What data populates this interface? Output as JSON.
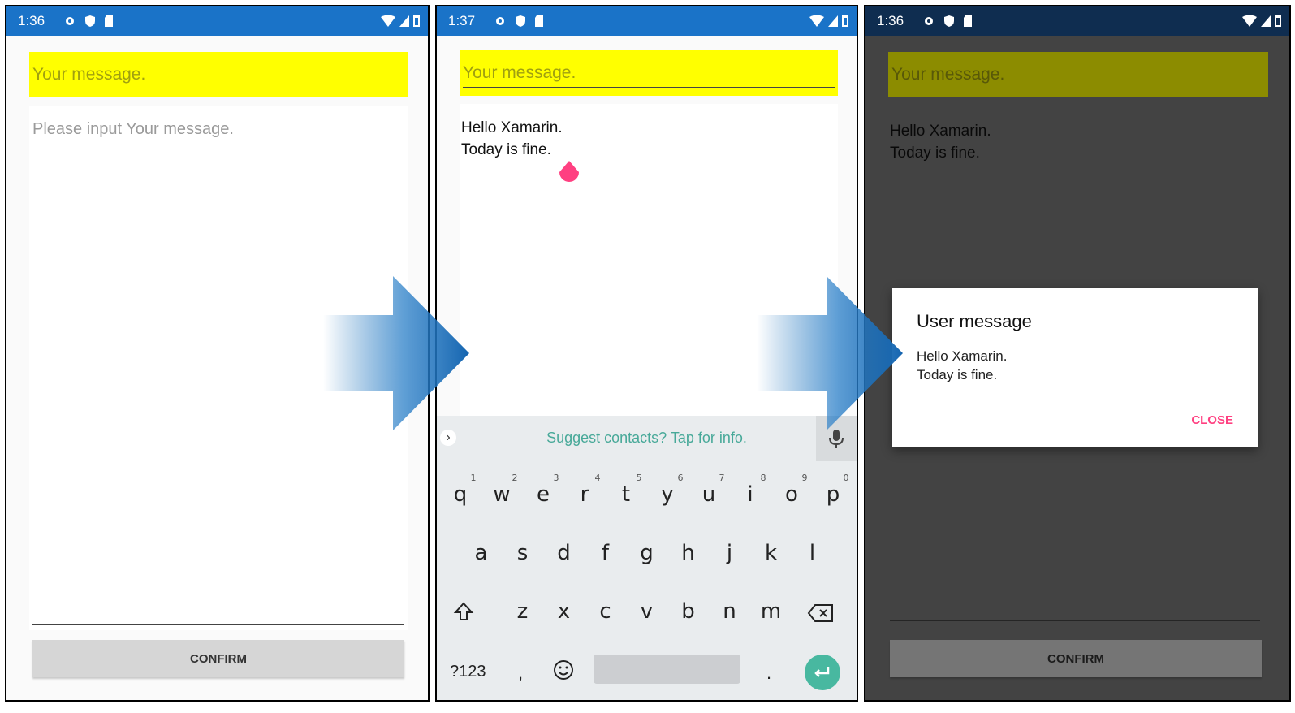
{
  "screens": [
    {
      "time": "1:36",
      "title_label": "Your message.",
      "placeholder": "Please input Your message.",
      "confirm_label": "CONFIRM"
    },
    {
      "time": "1:37",
      "title_label": "Your message.",
      "message_line1": "Hello Xamarin.",
      "message_line2": "Today is fine.",
      "suggestion": "Suggest contacts? Tap for info.",
      "keyboard": {
        "row1": [
          "q",
          "w",
          "e",
          "r",
          "t",
          "y",
          "u",
          "i",
          "o",
          "p"
        ],
        "row1_hints": [
          "1",
          "2",
          "3",
          "4",
          "5",
          "6",
          "7",
          "8",
          "9",
          "0"
        ],
        "row2": [
          "a",
          "s",
          "d",
          "f",
          "g",
          "h",
          "j",
          "k",
          "l"
        ],
        "row3": [
          "z",
          "x",
          "c",
          "v",
          "b",
          "n",
          "m"
        ],
        "symbols_label": "?123",
        "comma": ",",
        "period": "."
      }
    },
    {
      "time": "1:36",
      "title_label": "Your message.",
      "message_line1": "Hello Xamarin.",
      "message_line2": "Today is fine.",
      "confirm_label": "CONFIRM",
      "dialog": {
        "title": "User message",
        "line1": "Hello Xamarin.",
        "line2": "Today is fine.",
        "close_label": "CLOSE"
      }
    }
  ],
  "colors": {
    "statusbar": "#1a73c8",
    "title_highlight": "#ffff00",
    "accent": "#ff4081",
    "enter_key": "#48b8a0",
    "suggestion_text": "#48a999"
  }
}
